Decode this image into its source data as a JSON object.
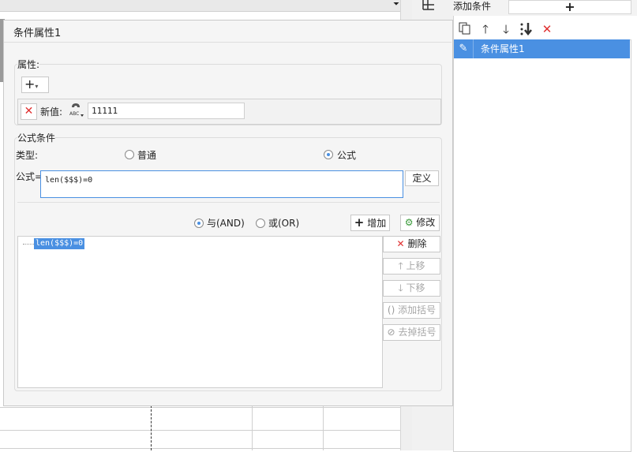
{
  "right_panel": {
    "title": "添加条件",
    "add_symbol": "+",
    "toolbar": {
      "copy_icon": "copy-icon",
      "up_icon": "arrow-up-icon",
      "down_icon": "arrow-down-icon",
      "move_bottom_icon": "move-to-bottom-icon",
      "delete_icon": "delete-icon"
    },
    "conditions": [
      {
        "label": "条件属性1",
        "selected": true
      }
    ]
  },
  "dialog": {
    "title": "条件属性1",
    "attributes": {
      "label": "属性:",
      "add_symbol": "+",
      "new_value_label": "新值:",
      "new_value": "11111"
    },
    "formula_condition": {
      "label": "公式条件",
      "type_label": "类型:",
      "type_options": [
        {
          "label": "普通",
          "selected": false
        },
        {
          "label": "公式",
          "selected": true
        }
      ],
      "formula_label": "公式=",
      "formula_value": "len($$$)=0",
      "define_button": "定义",
      "logic_options": [
        {
          "label": "与(AND)",
          "selected": true
        },
        {
          "label": "或(OR)",
          "selected": false
        }
      ],
      "add_button": "增加",
      "edit_button": "修改",
      "tree_items": [
        "len($$$)=0"
      ],
      "side_buttons": [
        {
          "label": "删除",
          "enabled": true
        },
        {
          "label": "上移",
          "enabled": false
        },
        {
          "label": "下移",
          "enabled": false
        },
        {
          "label": "添加括号",
          "enabled": false
        },
        {
          "label": "去掉括号",
          "enabled": false
        }
      ]
    }
  },
  "colors": {
    "selection": "#4a90e2",
    "delete_red": "#e03030",
    "dialog_bg": "#f5f5f5",
    "focus_border": "#4a90e2"
  }
}
